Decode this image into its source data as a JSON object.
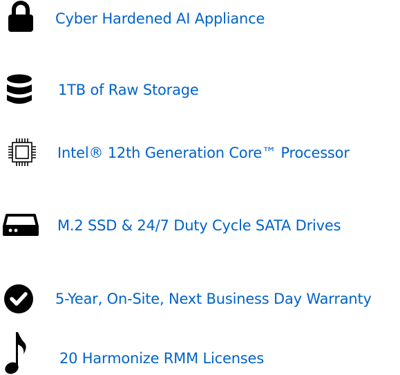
{
  "colors": {
    "text": "#0063c9",
    "icon": "#000000",
    "background": "#ffffff"
  },
  "features": [
    {
      "icon": "lock-icon",
      "label": "Cyber Hardened AI Appliance"
    },
    {
      "icon": "database-icon",
      "label": "1TB of Raw Storage"
    },
    {
      "icon": "cpu-chip-icon",
      "label": "Intel® 12th Generation Core™ Processor"
    },
    {
      "icon": "hard-drive-icon",
      "label": "M.2 SSD & 24/7 Duty Cycle SATA Drives"
    },
    {
      "icon": "check-circle-icon",
      "label": "5-Year, On-Site, Next Business Day Warranty"
    },
    {
      "icon": "music-note-icon",
      "label": "20 Harmonize RMM Licenses"
    }
  ]
}
